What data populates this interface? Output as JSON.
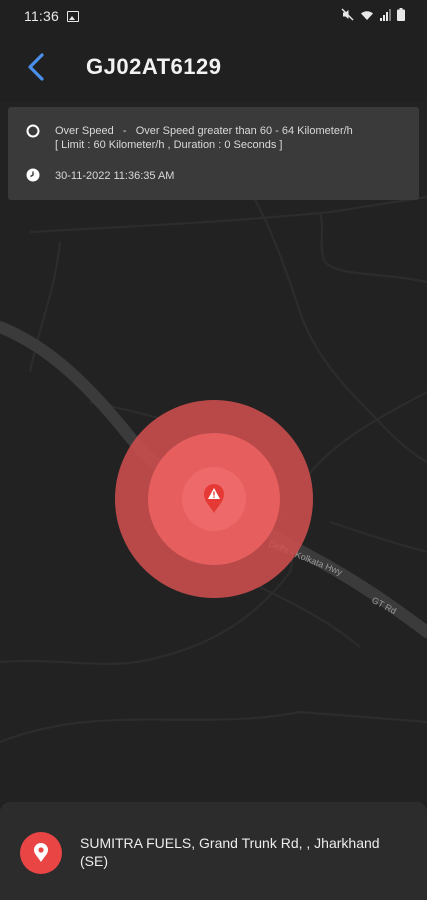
{
  "status_bar": {
    "time": "11:36"
  },
  "header": {
    "title": "GJ02AT6129"
  },
  "alert": {
    "type_label": "Over Speed",
    "separator": "-",
    "description": "Over Speed greater than 60 - 64 Kilometer/h",
    "details": "[ Limit : 60 Kilometer/h , Duration : 0 Seconds ]",
    "timestamp": "30-11-2022 11:36:35 AM"
  },
  "map": {
    "road_labels": [
      "Delhi - Kolkata Hwy",
      "GT Rd"
    ],
    "marker_color": "#e53935",
    "ring_outer_color": "#e05a5a",
    "ring_inner_color": "#ef6565"
  },
  "address": {
    "text": "SUMITRA FUELS, Grand Trunk Rd, , Jharkhand (SE)"
  },
  "colors": {
    "accent": "#4a8fe8",
    "alert_red": "#ea4545",
    "background": "#202020"
  }
}
